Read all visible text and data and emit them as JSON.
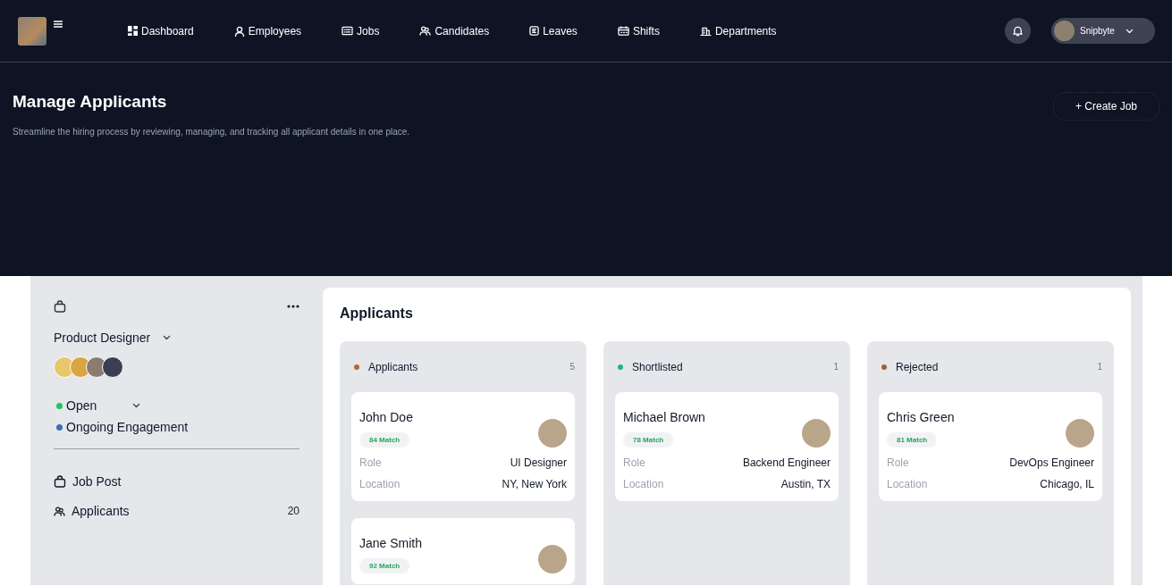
{
  "nav": {
    "items": [
      {
        "label": "Dashboard",
        "kind": "grid"
      },
      {
        "label": "Employees",
        "kind": "person"
      },
      {
        "label": "Jobs",
        "kind": "card"
      },
      {
        "label": "Candidates",
        "kind": "people"
      },
      {
        "label": "Leaves",
        "kind": "doc"
      },
      {
        "label": "Shifts",
        "kind": "calendar"
      },
      {
        "label": "Departments",
        "kind": "building"
      }
    ],
    "user": {
      "name": "Snipbyte"
    }
  },
  "header": {
    "title": "Manage Applicants",
    "subtitle": "Streamline the hiring process by reviewing, managing, and tracking all applicant details in one place.",
    "action": "+ Create Job"
  },
  "job": {
    "title": "Product Designer",
    "statuses": [
      {
        "label": "Open",
        "color": "#22c55e",
        "kind": "select"
      },
      {
        "label": "Ongoing Engagement",
        "color": "#3b6fb0",
        "kind": "plain"
      }
    ],
    "menu": [
      {
        "label": "Job Post",
        "kind": "bag"
      },
      {
        "label": "Applicants",
        "kind": "people",
        "count": "20"
      }
    ]
  },
  "board": {
    "title": "Applicants",
    "columns": [
      {
        "title": "Applicants",
        "count": "5",
        "color": "#b7652b",
        "cards": [
          {
            "name": "John Doe",
            "match": "84 Match",
            "fields": [
              {
                "label": "Role",
                "value": "UI Designer"
              },
              {
                "label": "Location",
                "value": "NY, New York"
              }
            ]
          },
          {
            "name": "Jane Smith",
            "match": "92 Match"
          }
        ]
      },
      {
        "title": "Shortlisted",
        "count": "1",
        "color": "#22b573",
        "cards": [
          {
            "name": "Michael Brown",
            "match": "78 Match",
            "fields": [
              {
                "label": "Role",
                "value": "Backend Engineer"
              },
              {
                "label": "Location",
                "value": "Austin, TX"
              }
            ]
          }
        ]
      },
      {
        "title": "Rejected",
        "count": "1",
        "color": "#a0613a",
        "cards": [
          {
            "name": "Chris Green",
            "match": "81 Match",
            "fields": [
              {
                "label": "Role",
                "value": "DevOps Engineer"
              },
              {
                "label": "Location",
                "value": "Chicago, IL"
              }
            ]
          }
        ]
      }
    ]
  }
}
